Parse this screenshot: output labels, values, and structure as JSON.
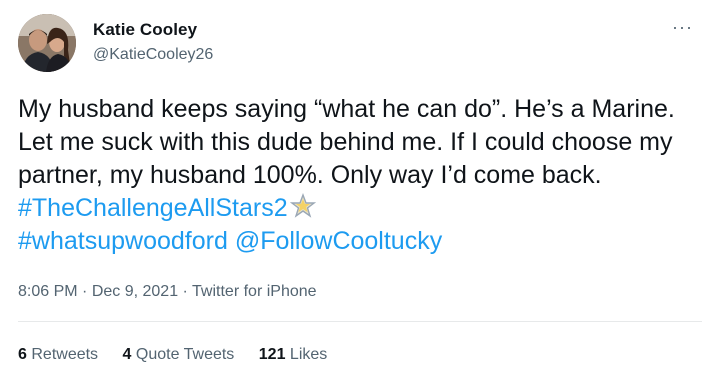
{
  "author": {
    "name": "Katie Cooley",
    "handle": "@KatieCooley26"
  },
  "menu": {
    "more_label": "···"
  },
  "tweet": {
    "text_part1": "My husband keeps saying “what he can do”. He’s a Marine. Let me suck with this dude behind me. If I could choose my partner, my husband 100%. Only way I’d come back. ",
    "hashtag1": "#TheChallengeAllStars2",
    "hashtag2": "#whatsupwoodford",
    "mention": "@FollowCooltucky",
    "emoji": "star-emoji"
  },
  "meta": {
    "time": "8:06 PM",
    "sep1": " · ",
    "date": "Dec 9, 2021",
    "sep2": " · ",
    "source": "Twitter for iPhone"
  },
  "stats": {
    "retweets_count": "6",
    "retweets_label": "Retweets",
    "quotes_count": "4",
    "quotes_label": "Quote Tweets",
    "likes_count": "121",
    "likes_label": "Likes"
  },
  "colors": {
    "link": "#1d9bf0",
    "secondary_text": "#536471",
    "primary_text": "#0f1419",
    "divider": "#e7e9ea"
  }
}
